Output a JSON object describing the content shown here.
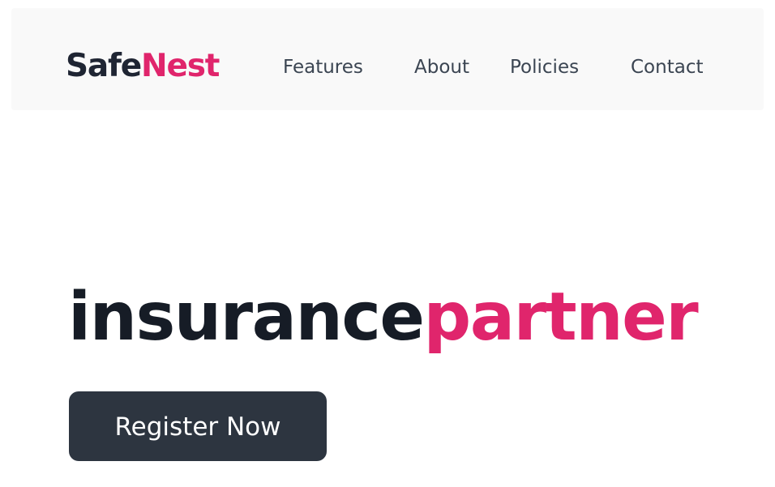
{
  "header": {
    "logo": {
      "part1": "Safe",
      "part2": "Nest"
    },
    "nav": [
      {
        "label": "Features"
      },
      {
        "label": "About"
      },
      {
        "label": "Policies"
      },
      {
        "label": "Contact"
      }
    ]
  },
  "hero": {
    "headline_dark": "insurance",
    "headline_accent": "partner",
    "cta_label": "Register Now"
  },
  "colors": {
    "brand_dark": "#1f2533",
    "accent": "#e0256c",
    "nav_text": "#3b4552",
    "button_bg": "#2d3540",
    "navbar_bg": "#f9f9f9"
  }
}
